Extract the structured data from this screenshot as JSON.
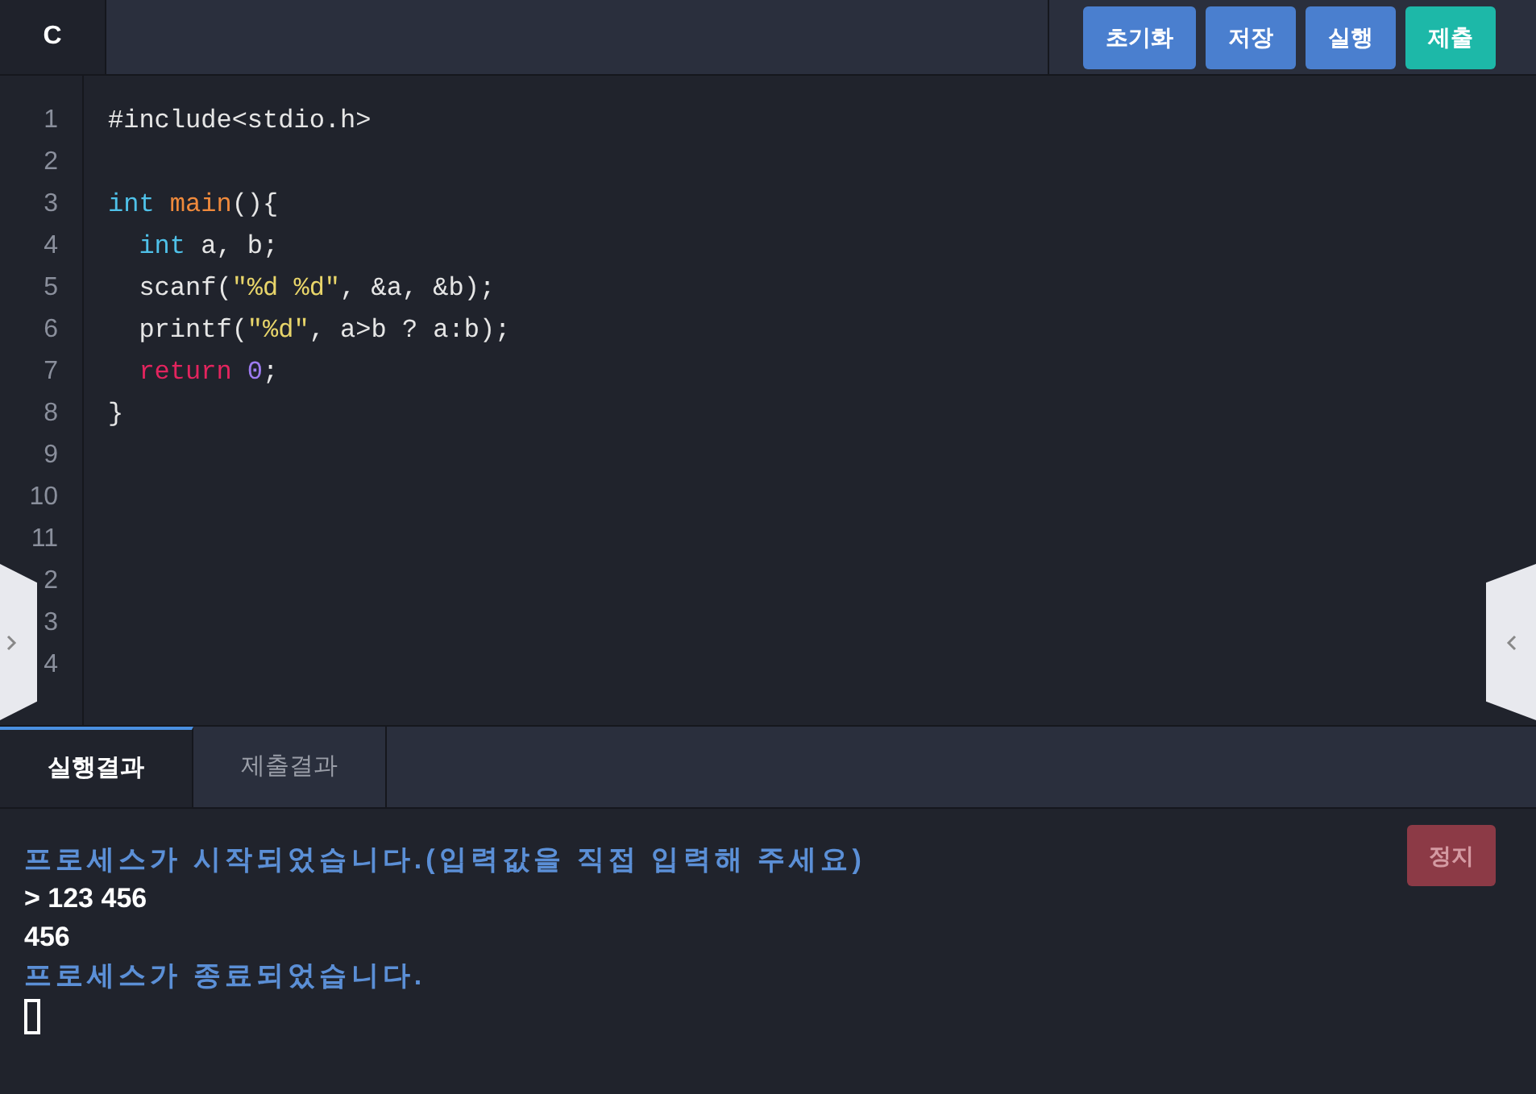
{
  "language_tab": {
    "label": "C",
    "selected": true
  },
  "toolbar": [
    {
      "label": "초기화",
      "kind": "action"
    },
    {
      "label": "저장",
      "kind": "action"
    },
    {
      "label": "실행",
      "kind": "action"
    },
    {
      "label": "제출",
      "kind": "submit"
    }
  ],
  "editor": {
    "lines": [
      {
        "number": "1",
        "tokens": [
          {
            "text": "#include<stdio.h>",
            "kind": "plain"
          }
        ]
      },
      {
        "number": "2"
      },
      {
        "number": "3",
        "tokens": [
          {
            "text": "int",
            "kind": "type"
          },
          {
            "text": " main",
            "kind": "function"
          },
          {
            "text": "(){",
            "kind": "plain"
          }
        ]
      },
      {
        "number": "4",
        "tokens": [
          {
            "text": "  int",
            "kind": "type"
          },
          {
            "text": " a, b;",
            "kind": "plain"
          }
        ]
      },
      {
        "number": "5",
        "tokens": [
          {
            "text": "  scanf(",
            "kind": "plain"
          },
          {
            "text": "\"%d %d\"",
            "kind": "string"
          },
          {
            "text": ", &a, &b);",
            "kind": "plain"
          }
        ]
      },
      {
        "number": "6",
        "tokens": [
          {
            "text": "  printf(",
            "kind": "plain"
          },
          {
            "text": "\"%d\"",
            "kind": "string"
          },
          {
            "text": ", a>b ? a:b);",
            "kind": "plain"
          }
        ]
      },
      {
        "number": "7",
        "tokens": [
          {
            "text": "  return",
            "kind": "keyword"
          },
          {
            "text": " 0",
            "kind": "number"
          },
          {
            "text": ";",
            "kind": "plain"
          }
        ]
      },
      {
        "number": "8",
        "tokens": [
          {
            "text": "}",
            "kind": "plain"
          }
        ]
      },
      {
        "number": "9"
      },
      {
        "number": "10"
      },
      {
        "number": "11"
      },
      {
        "number": "2"
      },
      {
        "number": "3"
      },
      {
        "number": "4"
      }
    ]
  },
  "output_tabs": [
    {
      "label": "실행결과",
      "selected": true
    },
    {
      "label": "제출결과",
      "selected": false
    }
  ],
  "console": {
    "stop_button": {
      "label": "정지",
      "disabled": true
    },
    "lines": [
      {
        "text": "프로세스가 시작되었습니다.(입력값을 직접 입력해 주세요)",
        "kind": "system"
      },
      {
        "text": "> 123 456",
        "kind": "input"
      },
      {
        "text": "456",
        "kind": "output"
      },
      {
        "text": "프로세스가 종료되었습니다.",
        "kind": "system"
      }
    ],
    "cursor": true
  }
}
